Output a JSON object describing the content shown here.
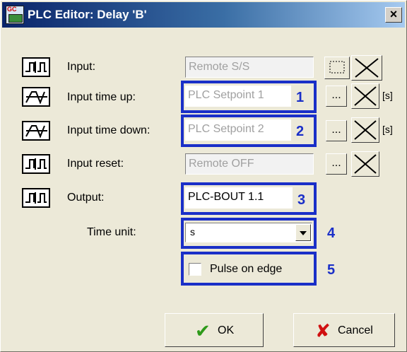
{
  "window": {
    "title": "PLC Editor: Delay 'B'",
    "close_glyph": "×"
  },
  "rows": [
    {
      "label": "Input:",
      "value": "Remote S/S",
      "icon": "digital-input-icon"
    },
    {
      "label": "Input time up:",
      "value": "PLC Setpoint 1",
      "icon": "analog-input-icon",
      "unit": "[s]",
      "annotation": "1"
    },
    {
      "label": "Input time down:",
      "value": "PLC Setpoint 2",
      "icon": "analog-input-icon",
      "unit": "[s]",
      "annotation": "2"
    },
    {
      "label": "Input reset:",
      "value": "Remote OFF",
      "icon": "digital-input-icon"
    },
    {
      "label": "Output:",
      "value": "PLC-BOUT 1.1",
      "icon": "digital-output-icon",
      "annotation": "3"
    }
  ],
  "time_unit": {
    "label": "Time unit:",
    "selected": "s",
    "annotation": "4"
  },
  "pulse": {
    "label": "Pulse on edge",
    "checked": false,
    "annotation": "5"
  },
  "buttons": {
    "dots": "...",
    "ok": "OK",
    "cancel": "Cancel"
  },
  "colors": {
    "highlight": "#1a2fc8",
    "ok_check": "#2e9a1a",
    "cancel_x": "#d01010"
  }
}
